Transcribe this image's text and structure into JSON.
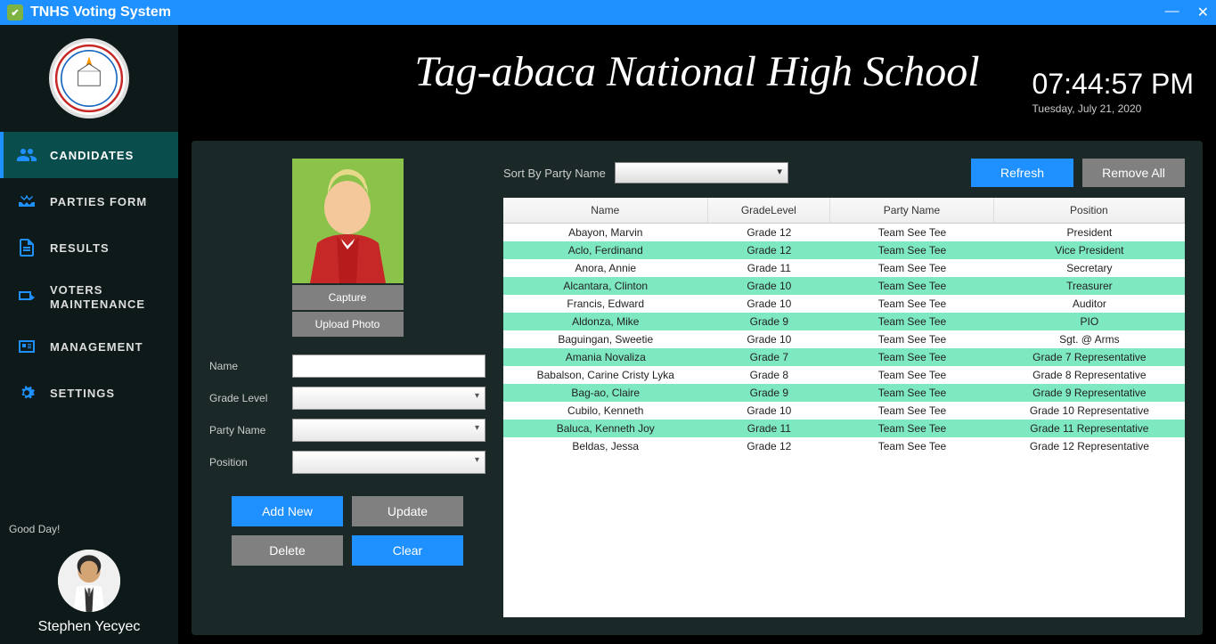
{
  "titlebar": {
    "title": "TNHS Voting System"
  },
  "header": {
    "school": "Tag-abaca National High School",
    "time": "07:44:57 PM",
    "date": "Tuesday, July 21, 2020"
  },
  "sidebar": {
    "items": [
      {
        "label": "CANDIDATES"
      },
      {
        "label": "PARTIES FORM"
      },
      {
        "label": "RESULTS"
      },
      {
        "label": "VOTERS MAINTENANCE"
      },
      {
        "label": "MANAGEMENT"
      },
      {
        "label": "SETTINGS"
      }
    ],
    "greeting": "Good Day!",
    "username": "Stephen Yecyec"
  },
  "form": {
    "capture": "Capture",
    "upload": "Upload Photo",
    "labels": {
      "name": "Name",
      "grade": "Grade Level",
      "party": "Party Name",
      "position": "Position"
    },
    "values": {
      "name": "",
      "grade": "",
      "party": "",
      "position": ""
    },
    "buttons": {
      "add": "Add New",
      "update": "Update",
      "delete": "Delete",
      "clear": "Clear"
    }
  },
  "toolbar": {
    "sort_label": "Sort By Party Name",
    "refresh": "Refresh",
    "remove_all": "Remove All"
  },
  "table": {
    "headers": {
      "name": "Name",
      "grade": "GradeLevel",
      "party": "Party Name",
      "position": "Position"
    },
    "rows": [
      {
        "name": "Abayon, Marvin",
        "grade": "Grade 12",
        "party": "Team See Tee",
        "position": "President"
      },
      {
        "name": "Aclo, Ferdinand",
        "grade": "Grade 12",
        "party": "Team See Tee",
        "position": "Vice President"
      },
      {
        "name": "Anora, Annie",
        "grade": "Grade 11",
        "party": "Team See Tee",
        "position": "Secretary"
      },
      {
        "name": "Alcantara, Clinton",
        "grade": "Grade 10",
        "party": "Team See Tee",
        "position": "Treasurer"
      },
      {
        "name": "Francis, Edward",
        "grade": "Grade 10",
        "party": "Team See Tee",
        "position": "Auditor"
      },
      {
        "name": "Aldonza, Mike",
        "grade": "Grade 9",
        "party": "Team See Tee",
        "position": "PIO"
      },
      {
        "name": "Baguingan, Sweetie",
        "grade": "Grade 10",
        "party": "Team See Tee",
        "position": "Sgt. @ Arms"
      },
      {
        "name": "Amania Novaliza",
        "grade": "Grade 7",
        "party": "Team See Tee",
        "position": "Grade 7 Representative"
      },
      {
        "name": "Babalson, Carine Cristy Lyka",
        "grade": "Grade 8",
        "party": "Team See Tee",
        "position": "Grade 8 Representative"
      },
      {
        "name": "Bag-ao, Claire",
        "grade": "Grade 9",
        "party": "Team See Tee",
        "position": "Grade 9 Representative"
      },
      {
        "name": "Cubilo, Kenneth",
        "grade": "Grade 10",
        "party": "Team See Tee",
        "position": "Grade 10 Representative"
      },
      {
        "name": "Baluca, Kenneth Joy",
        "grade": "Grade 11",
        "party": "Team See Tee",
        "position": "Grade 11 Representative"
      },
      {
        "name": "Beldas, Jessa",
        "grade": "Grade 12",
        "party": "Team See Tee",
        "position": "Grade 12 Representative"
      }
    ]
  }
}
